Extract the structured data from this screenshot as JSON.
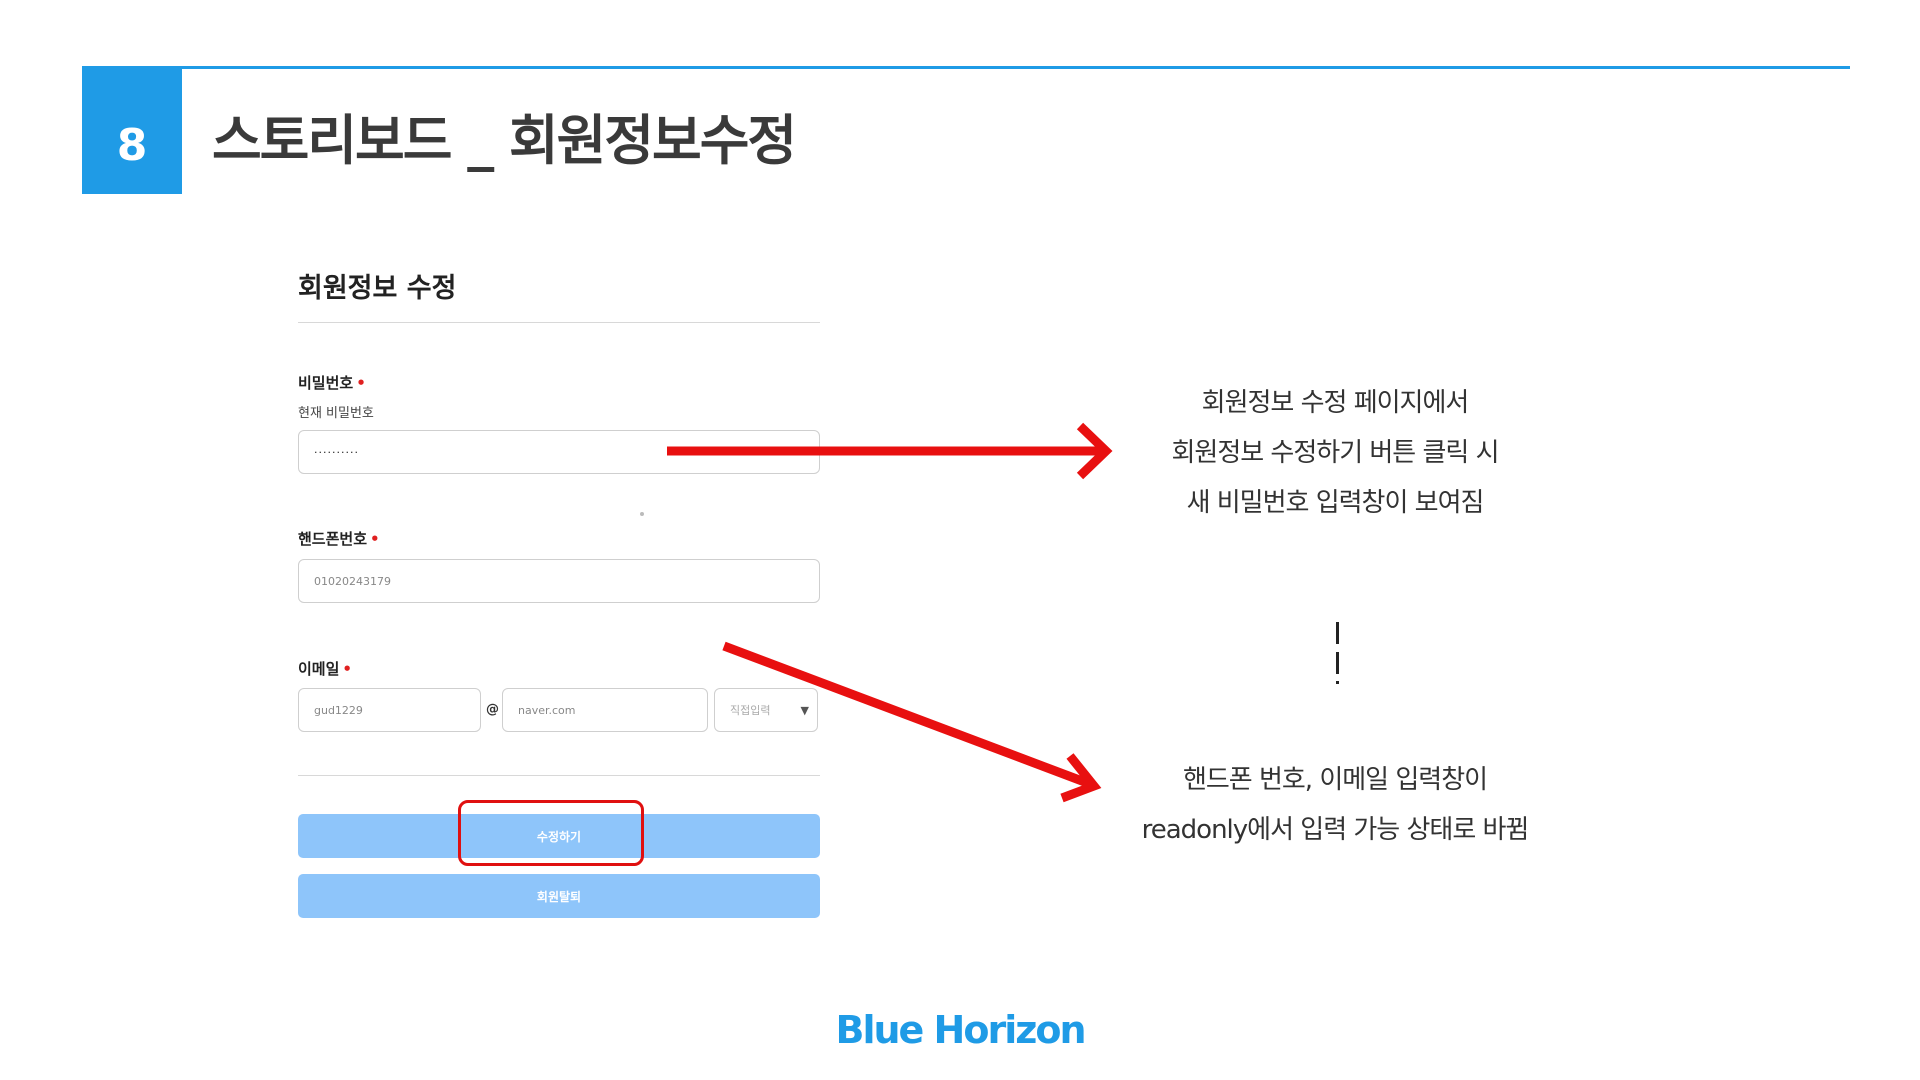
{
  "slide": {
    "number": "8",
    "title": "스토리보드 _  회원정보수정"
  },
  "form": {
    "title": "회원정보 수정",
    "password": {
      "label": "비밀번호",
      "required_mark": "•",
      "sublabel": "현재 비밀번호",
      "value": "··········"
    },
    "phone": {
      "label": "핸드폰번호",
      "required_mark": "•",
      "value": "01020243179"
    },
    "email": {
      "label": "이메일",
      "required_mark": "•",
      "local_value": "gud1229",
      "at_symbol": "@",
      "domain_value": "naver.com",
      "domain_select": "직접입력"
    },
    "buttons": {
      "edit": "수정하기",
      "withdraw": "회원탈퇴"
    }
  },
  "annotations": {
    "note1": [
      "회원정보 수정 페이지에서",
      "회원정보 수정하기 버튼 클릭 시",
      "새 비밀번호 입력창이 보여짐"
    ],
    "note2": [
      "핸드폰 번호, 이메일 입력창이",
      "readonly에서 입력 가능 상태로 바뀜"
    ]
  },
  "brand": "Blue Horizon",
  "colors": {
    "accent": "#1f9be6",
    "arrow": "#e81010",
    "button": "#8ec5fa"
  }
}
